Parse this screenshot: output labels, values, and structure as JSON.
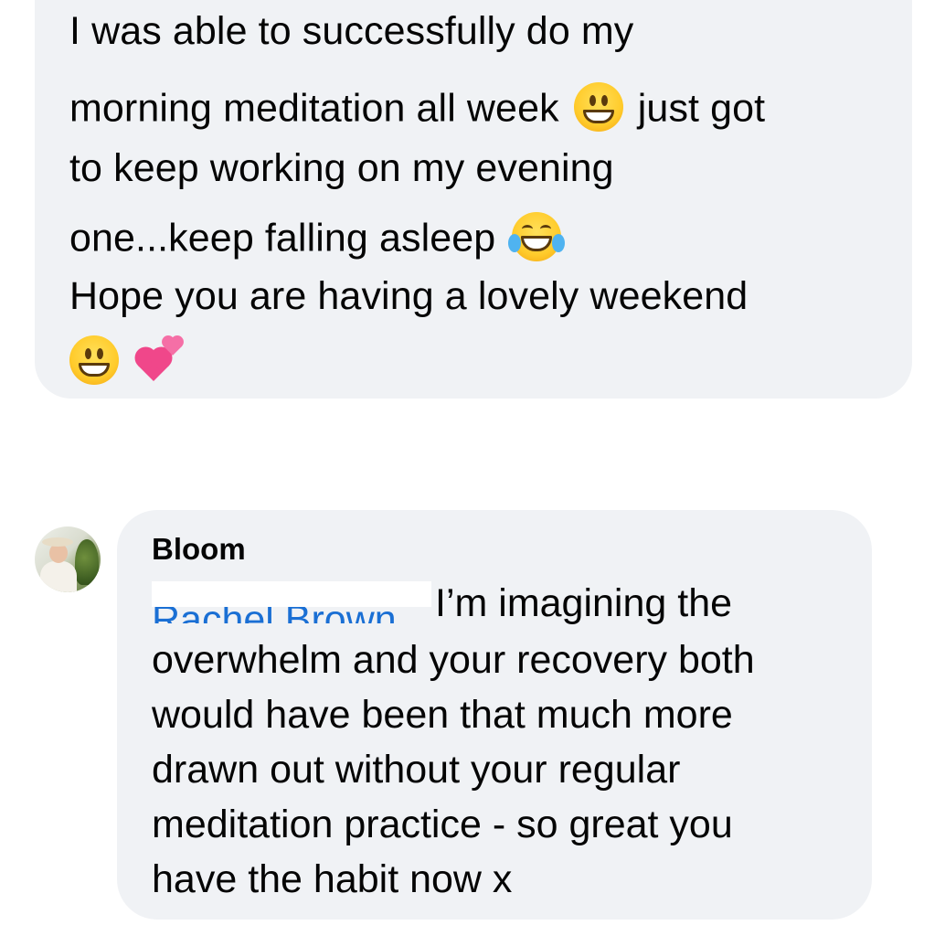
{
  "top_comment": {
    "lines": {
      "l1": "I was able to successfully do my",
      "l2a": "morning meditation all week",
      "l2b": "just got",
      "l3": "to keep working on my evening",
      "l4": "one...keep falling asleep",
      "l5": "Hope you are having a lovely weekend"
    },
    "icons": [
      "grinning-face-icon",
      "tears-of-joy-face-icon",
      "two-hearts-icon"
    ]
  },
  "reply": {
    "author": "Bloom",
    "mention": "Rachel Brown",
    "lines": {
      "r1": "I’m imagining the",
      "r2": "overwhelm and your recovery both",
      "r3": "would have been that much more",
      "r4": "drawn out without your regular",
      "r5": "meditation practice - so great you",
      "r6": "have the habit now x"
    }
  },
  "colors": {
    "bubble": "#f0f2f5",
    "text": "#050505",
    "mention": "#1a6fd4",
    "background": "#ffffff"
  }
}
